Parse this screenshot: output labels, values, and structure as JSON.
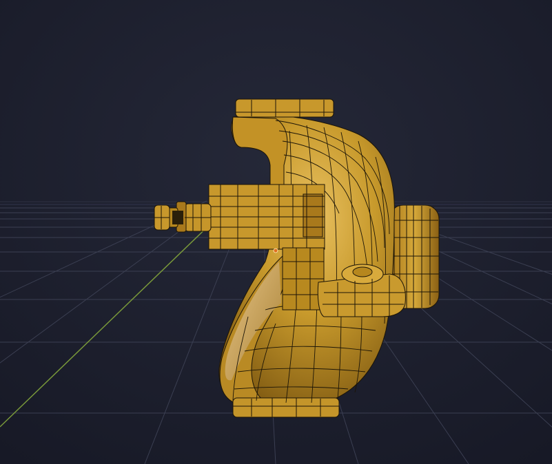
{
  "viewport": {
    "view": "3d-viewport",
    "background_color": "#1a1c2b",
    "grid_color": "#3b3f52",
    "y_axis_color": "#7a9a3a",
    "object": {
      "kind": "mesh",
      "display": "solid-with-wireframe",
      "base_color": "#c89a2c",
      "shadow_color": "#7a5510",
      "highlight_color": "#e8c060",
      "wire_color": "#1b1407",
      "origin_marker_color": "#e07020"
    }
  }
}
